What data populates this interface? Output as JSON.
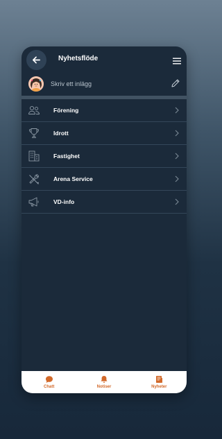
{
  "header": {
    "title": "Nyhetsflöde"
  },
  "composer": {
    "placeholder": "Skriv ett inlägg"
  },
  "feeds": [
    {
      "label": "Förening",
      "icon": "people-icon"
    },
    {
      "label": "Idrott",
      "icon": "trophy-icon"
    },
    {
      "label": "Fastighet",
      "icon": "building-icon"
    },
    {
      "label": "Arena Service",
      "icon": "tools-icon"
    },
    {
      "label": "VD-info",
      "icon": "megaphone-icon"
    }
  ],
  "tabs": [
    {
      "label": "Chatt",
      "icon": "chat-icon"
    },
    {
      "label": "Notiser",
      "icon": "bell-icon"
    },
    {
      "label": "Nyheter",
      "icon": "news-icon"
    }
  ],
  "colors": {
    "accent": "#d2692a",
    "panel": "#1b2a3a",
    "separator": "#34475a"
  }
}
